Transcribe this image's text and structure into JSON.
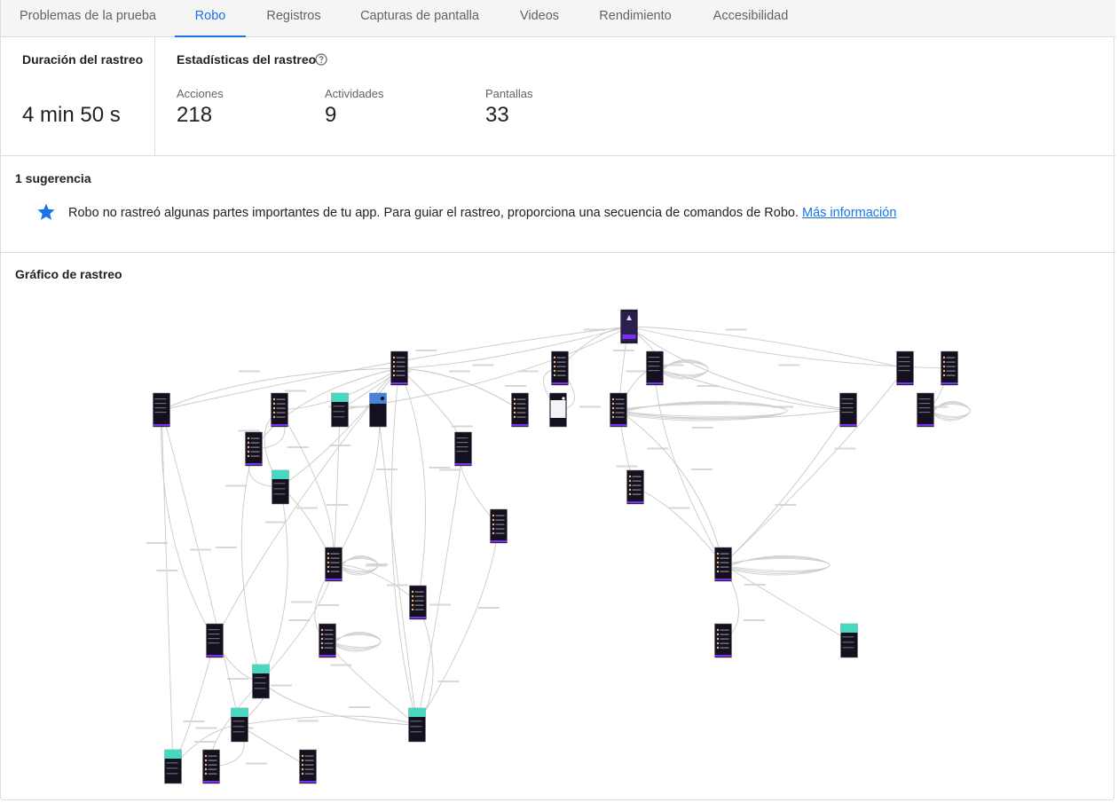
{
  "tabs": [
    {
      "label": "Problemas de la prueba",
      "active": false
    },
    {
      "label": "Robo",
      "active": true
    },
    {
      "label": "Registros",
      "active": false
    },
    {
      "label": "Capturas de pantalla",
      "active": false
    },
    {
      "label": "Videos",
      "active": false
    },
    {
      "label": "Rendimiento",
      "active": false
    },
    {
      "label": "Accesibilidad",
      "active": false
    }
  ],
  "duration": {
    "title": "Duración del rastreo",
    "value": "4 min 50 s"
  },
  "stats": {
    "title": "Estadísticas del rastreo",
    "help_icon": "help-circle-icon",
    "items": [
      {
        "label": "Acciones",
        "value": "218"
      },
      {
        "label": "Actividades",
        "value": "9"
      },
      {
        "label": "Pantallas",
        "value": "33"
      }
    ]
  },
  "suggestions": {
    "title": "1 sugerencia",
    "icon": "star-icon",
    "icon_color": "#1a73e8",
    "text": "Robo no rastreó algunas partes importantes de tu app. Para guiar el rastreo, proporciona una secuencia de comandos de Robo.",
    "link": "Más información"
  },
  "graph": {
    "title": "Gráfico de rastreo",
    "screen_count": 33,
    "screen_styles": [
      "launcher",
      "list",
      "list",
      "dark",
      "dark",
      "list",
      "dark",
      "list",
      "teal",
      "blue",
      "list",
      "white",
      "list",
      "dark",
      "dark",
      "list",
      "dark",
      "teal",
      "list",
      "list",
      "list",
      "list",
      "list",
      "dark",
      "list",
      "list",
      "teal",
      "teal",
      "teal",
      "teal",
      "teal",
      "list",
      "list"
    ]
  }
}
